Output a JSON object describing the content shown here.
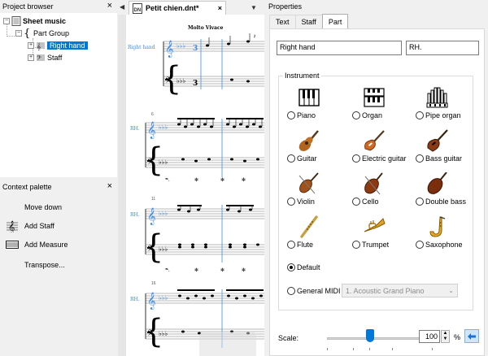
{
  "project_browser": {
    "title": "Project browser",
    "close_icon": "close-icon",
    "tree": {
      "root": "Sheet music",
      "group": "Part Group",
      "part_selected": "Right hand",
      "staff": "Staff"
    }
  },
  "context_palette": {
    "title": "Context palette",
    "items": [
      {
        "label": "Move down",
        "icon": null
      },
      {
        "label": "Add Staff",
        "icon": "treble-clef-icon"
      },
      {
        "label": "Add Measure",
        "icon": "measure-icon"
      },
      {
        "label": "Transpose...",
        "icon": null
      }
    ]
  },
  "document": {
    "tab_label": "Petit chien.dnt*",
    "tempo": "Molto Vivace",
    "staff_label_first": "Right hand",
    "staff_label_short": "RH.",
    "measure_numbers": [
      "6",
      "11",
      "16"
    ]
  },
  "properties": {
    "title": "Properties",
    "tabs": [
      "Text",
      "Staff",
      "Part"
    ],
    "active_tab": "Part",
    "name_value": "Right hand",
    "short_name_value": "RH.",
    "instrument_group_label": "Instrument",
    "instruments": [
      {
        "label": "Piano",
        "icon": "piano-icon"
      },
      {
        "label": "Organ",
        "icon": "organ-icon"
      },
      {
        "label": "Pipe organ",
        "icon": "pipe-organ-icon"
      },
      {
        "label": "Guitar",
        "icon": "guitar-icon"
      },
      {
        "label": "Electric guitar",
        "icon": "electric-guitar-icon"
      },
      {
        "label": "Bass guitar",
        "icon": "bass-guitar-icon"
      },
      {
        "label": "Violin",
        "icon": "violin-icon"
      },
      {
        "label": "Cello",
        "icon": "cello-icon"
      },
      {
        "label": "Double bass",
        "icon": "double-bass-icon"
      },
      {
        "label": "Flute",
        "icon": "flute-icon"
      },
      {
        "label": "Trumpet",
        "icon": "trumpet-icon"
      },
      {
        "label": "Saxophone",
        "icon": "saxophone-icon"
      }
    ],
    "default_label": "Default",
    "default_checked": true,
    "general_midi_label": "General MIDI",
    "midi_value": "1. Acoustic Grand Piano",
    "scale_label": "Scale:",
    "scale_value": "100",
    "scale_unit": "%"
  },
  "colors": {
    "selection": "#0078d7",
    "staff_label_blue": "#3c8ce6",
    "panel_bg": "#f0f0f0"
  }
}
